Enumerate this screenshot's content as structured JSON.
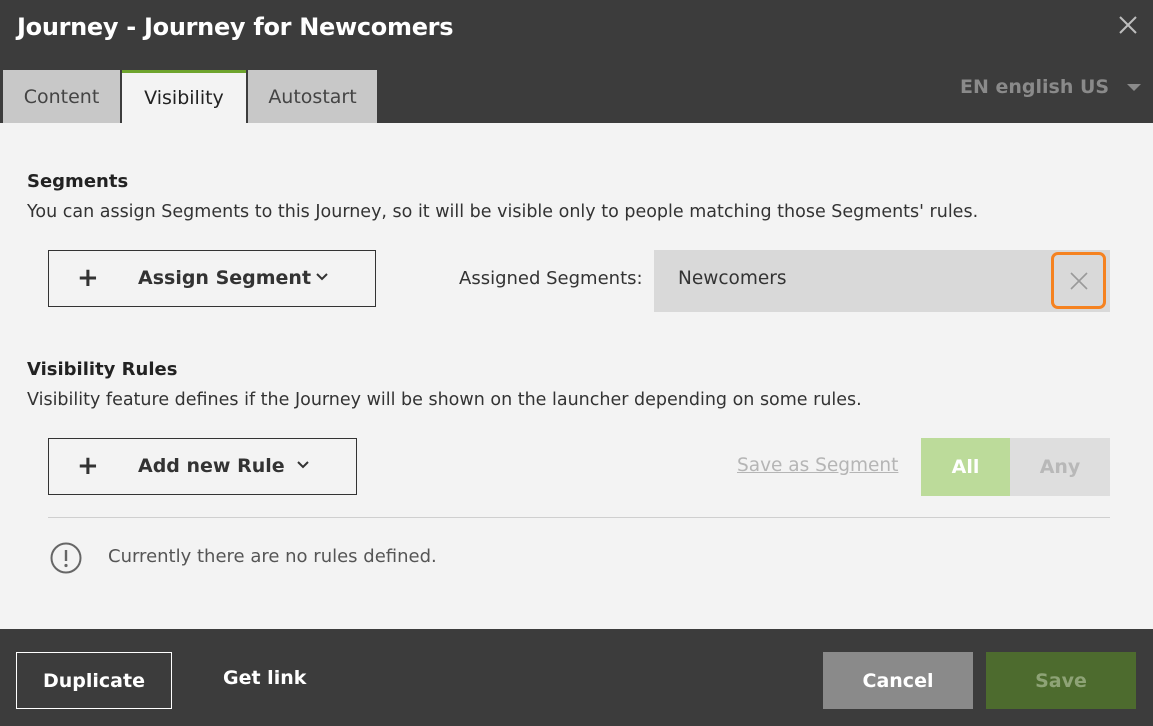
{
  "dialog": {
    "title": "Journey - Journey for Newcomers"
  },
  "tabs": [
    {
      "label": "Content"
    },
    {
      "label": "Visibility"
    },
    {
      "label": "Autostart"
    }
  ],
  "language": {
    "selected": "EN english US"
  },
  "segments": {
    "title": "Segments",
    "description": "You can assign Segments to this Journey, so it will be visible only to people matching those Segments' rules.",
    "assign_button_label": "Assign Segment",
    "assigned_label": "Assigned Segments:",
    "assigned": [
      "Newcomers"
    ]
  },
  "visibility_rules": {
    "title": "Visibility Rules",
    "description": "Visibility feature defines if the Journey will be shown on the launcher depending on some rules.",
    "add_button_label": "Add new Rule",
    "save_as_segment_label": "Save as Segment",
    "match_options": [
      {
        "label": "All"
      },
      {
        "label": "Any"
      }
    ],
    "empty_message": "Currently there are no rules defined."
  },
  "footer": {
    "duplicate_label": "Duplicate",
    "get_link_label": "Get link",
    "cancel_label": "Cancel",
    "save_label": "Save"
  },
  "colors": {
    "header_bg": "#3c3c3c",
    "body_bg": "#f3f3f3",
    "accent_green": "#6ea42d",
    "highlight_orange": "#f58220",
    "save_bg": "#4d6b2e"
  },
  "icons": {
    "close": "close-icon",
    "language_caret": "caret-down-icon",
    "plus": "plus-icon",
    "chevron": "chevron-down-icon",
    "remove": "remove-x-icon",
    "info": "exclamation-circle-icon"
  }
}
